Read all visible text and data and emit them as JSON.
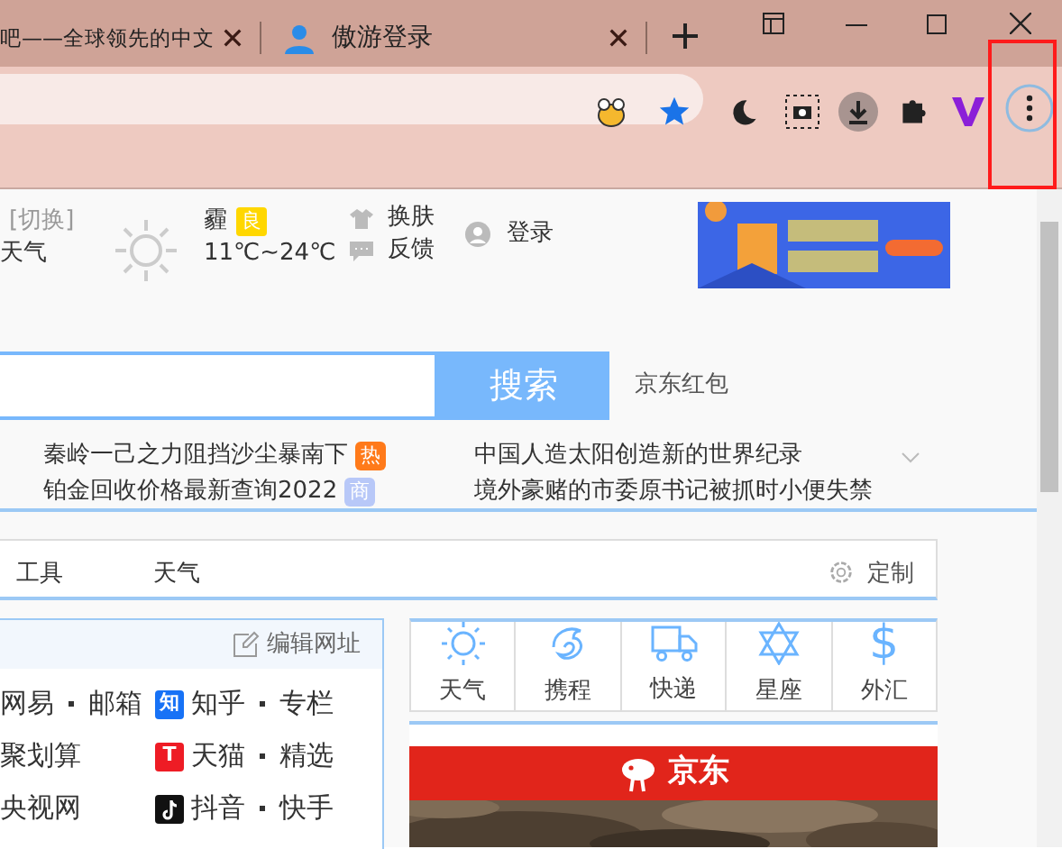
{
  "tabs": [
    {
      "title": "吧——全球领先的中文"
    },
    {
      "title": "傲游登录"
    }
  ],
  "header": {
    "city_switch": "[切换]",
    "weather_link": "天气",
    "condition": "霾",
    "air_quality": "良",
    "temperature": "11℃~24℃",
    "links": [
      "换肤",
      "反馈"
    ],
    "login": "登录"
  },
  "search": {
    "button": "搜索",
    "hot_link": "京东红包"
  },
  "news_left": [
    {
      "text": "秦岭一己之力阻挡沙尘暴南下",
      "tag": "热",
      "kind": "hot"
    },
    {
      "text": "铂金回收价格最新查询2022",
      "tag": "商",
      "kind": "ad"
    }
  ],
  "news_right": [
    "中国人造太阳创造新的世界纪录",
    "境外豪赌的市委原书记被抓时小便失禁"
  ],
  "nav": {
    "items": [
      "工具",
      "天气"
    ],
    "customize": "定制"
  },
  "sites": {
    "edit": "编辑网址",
    "rows": [
      {
        "left": [
          "网易",
          "邮箱"
        ],
        "logo": {
          "kind": "letter",
          "text": "知",
          "color": "#1772f6"
        },
        "right": [
          "知乎",
          "专栏"
        ]
      },
      {
        "left": [
          "聚划算"
        ],
        "logo": {
          "kind": "letter",
          "text": "T",
          "color": "#ee1c25"
        },
        "right": [
          "天猫",
          "精选"
        ]
      },
      {
        "left": [
          "央视网"
        ],
        "logo": {
          "kind": "note",
          "color": "#111111"
        },
        "right": [
          "抖音",
          "快手"
        ]
      }
    ]
  },
  "tools": [
    {
      "label": "天气",
      "kind": "sun"
    },
    {
      "label": "携程",
      "kind": "dolphin"
    },
    {
      "label": "快递",
      "kind": "truck"
    },
    {
      "label": "星座",
      "kind": "star"
    },
    {
      "label": "外汇",
      "kind": "glyph",
      "glyph": "$"
    }
  ],
  "jd_banner": {
    "brand": "京东"
  }
}
